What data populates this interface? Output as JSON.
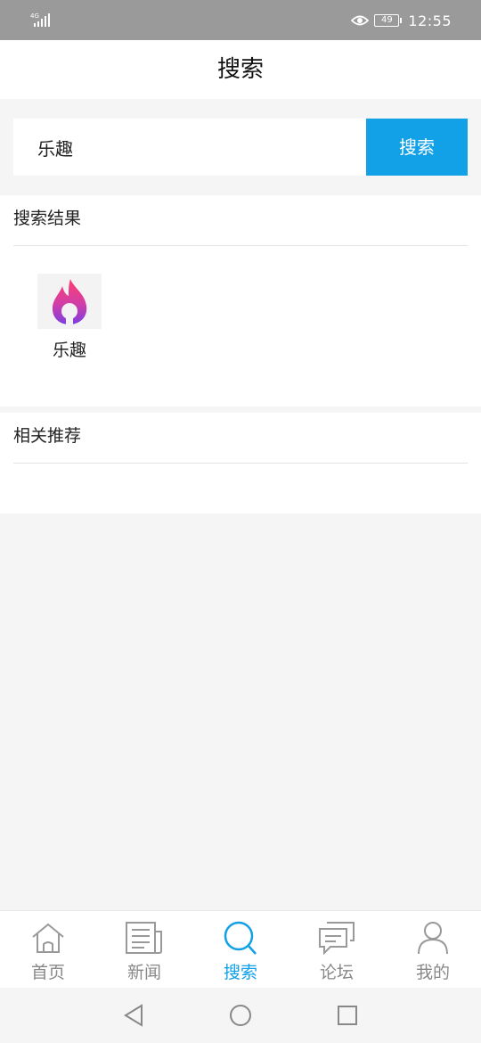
{
  "status_bar": {
    "network": "4G",
    "battery": "49",
    "time": "12:55"
  },
  "header": {
    "title": "搜索"
  },
  "search": {
    "value": "乐趣",
    "button_label": "搜索"
  },
  "results": {
    "heading": "搜索结果",
    "items": [
      {
        "name": "乐趣",
        "icon": "flame-app-icon"
      }
    ]
  },
  "recommend": {
    "heading": "相关推荐"
  },
  "tabs": [
    {
      "label": "首页",
      "icon": "home-icon"
    },
    {
      "label": "新闻",
      "icon": "newspaper-icon"
    },
    {
      "label": "搜索",
      "icon": "search-icon",
      "active": true
    },
    {
      "label": "论坛",
      "icon": "forum-icon"
    },
    {
      "label": "我的",
      "icon": "user-icon"
    }
  ],
  "colors": {
    "accent": "#12a0e6",
    "statusbar": "#9a9a9a",
    "background": "#f5f5f5",
    "inactive": "#888888"
  }
}
